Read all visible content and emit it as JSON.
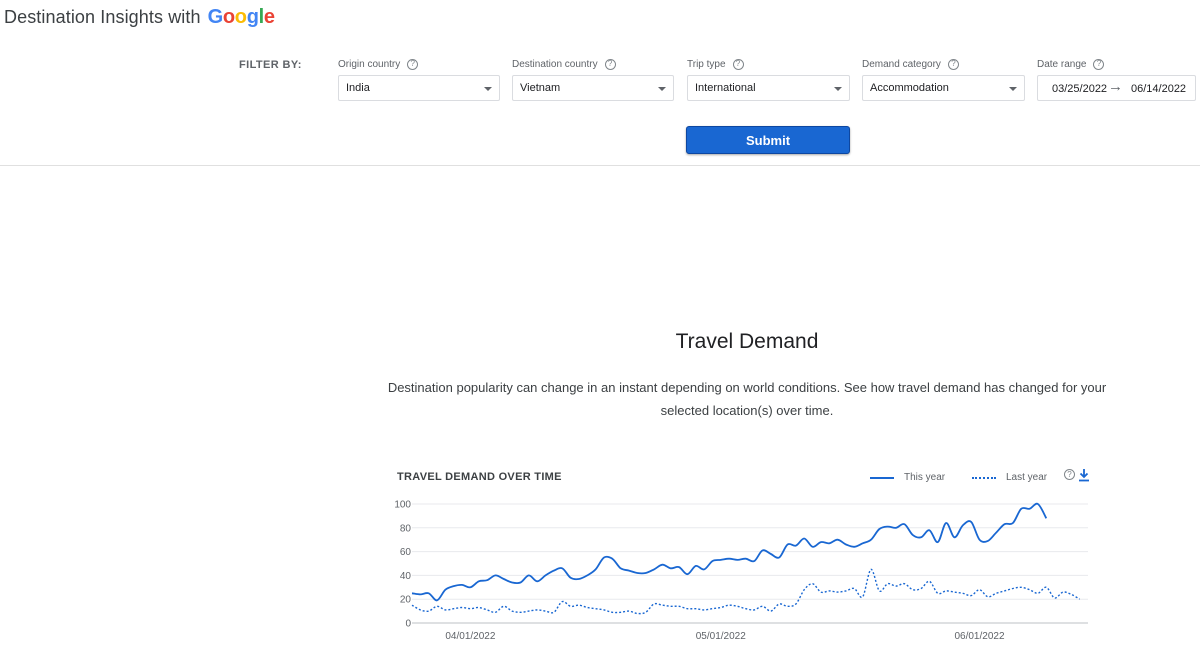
{
  "header": {
    "title": "Destination Insights with",
    "brand": "Google",
    "brand_colors": [
      "#4285f4",
      "#ea4335",
      "#fbbc05",
      "#4285f4",
      "#34a853",
      "#ea4335"
    ]
  },
  "filters": {
    "label": "FILTER BY:",
    "origin": {
      "label": "Origin country",
      "value": "India"
    },
    "destination": {
      "label": "Destination country",
      "value": "Vietnam"
    },
    "trip_type": {
      "label": "Trip type",
      "value": "International"
    },
    "demand_category": {
      "label": "Demand category",
      "value": "Accommodation"
    },
    "date_range": {
      "label": "Date range",
      "start": "03/25/2022",
      "end": "06/14/2022"
    },
    "help_glyph": "?",
    "submit_label": "Submit"
  },
  "section": {
    "title": "Travel Demand",
    "description": "Destination popularity can change in an instant depending on world conditions. See how travel demand has changed for your selected location(s) over time."
  },
  "colors": {
    "accent": "#1967d2",
    "grid": "#e8eaed"
  },
  "chart_data": {
    "type": "line",
    "title": "TRAVEL DEMAND OVER TIME",
    "ylim": [
      0,
      100
    ],
    "yticks": [
      0,
      20,
      40,
      60,
      80,
      100
    ],
    "x_tick_labels": [
      {
        "label": "04/01/2022",
        "day": 7
      },
      {
        "label": "05/01/2022",
        "day": 37
      },
      {
        "label": "06/01/2022",
        "day": 68
      }
    ],
    "x": [
      "03/25",
      "03/26",
      "03/27",
      "03/28",
      "03/29",
      "03/30",
      "03/31",
      "04/01",
      "04/02",
      "04/03",
      "04/04",
      "04/05",
      "04/06",
      "04/07",
      "04/08",
      "04/09",
      "04/10",
      "04/11",
      "04/12",
      "04/13",
      "04/14",
      "04/15",
      "04/16",
      "04/17",
      "04/18",
      "04/19",
      "04/20",
      "04/21",
      "04/22",
      "04/23",
      "04/24",
      "04/25",
      "04/26",
      "04/27",
      "04/28",
      "04/29",
      "04/30",
      "05/01",
      "05/02",
      "05/03",
      "05/04",
      "05/05",
      "05/06",
      "05/07",
      "05/08",
      "05/09",
      "05/10",
      "05/11",
      "05/12",
      "05/13",
      "05/14",
      "05/15",
      "05/16",
      "05/17",
      "05/18",
      "05/19",
      "05/20",
      "05/21",
      "05/22",
      "05/23",
      "05/24",
      "05/25",
      "05/26",
      "05/27",
      "05/28",
      "05/29",
      "05/30",
      "05/31",
      "06/01",
      "06/02",
      "06/03",
      "06/04",
      "06/05",
      "06/06",
      "06/07",
      "06/08",
      "06/09",
      "06/10",
      "06/11",
      "06/12",
      "06/13",
      "06/14"
    ],
    "series": [
      {
        "name": "This year",
        "style": "solid",
        "values": [
          25,
          24,
          25,
          19,
          28,
          31,
          32,
          30,
          35,
          36,
          40,
          37,
          34,
          34,
          40,
          35,
          40,
          44,
          46,
          38,
          37,
          40,
          45,
          55,
          54,
          46,
          44,
          42,
          42,
          45,
          49,
          46,
          47,
          41,
          48,
          45,
          52,
          53,
          54,
          53,
          54,
          52,
          61,
          58,
          55,
          66,
          65,
          71,
          64,
          68,
          67,
          70,
          66,
          64,
          67,
          70,
          79,
          81,
          80,
          83,
          74,
          72,
          78,
          68,
          84,
          72,
          82,
          85,
          70,
          69,
          76,
          83,
          84,
          96,
          96,
          100,
          88
        ]
      },
      {
        "name": "Last year",
        "style": "dotted",
        "values": [
          15,
          11,
          10,
          14,
          11,
          12,
          13,
          12,
          13,
          11,
          9,
          14,
          10,
          9,
          10,
          11,
          10,
          9,
          18,
          14,
          15,
          13,
          12,
          11,
          9,
          9,
          10,
          8,
          9,
          16,
          15,
          14,
          14,
          12,
          12,
          11,
          12,
          13,
          15,
          14,
          12,
          11,
          14,
          10,
          16,
          14,
          16,
          28,
          33,
          26,
          27,
          26,
          27,
          29,
          22,
          45,
          27,
          33,
          31,
          33,
          28,
          29,
          35,
          25,
          27,
          26,
          25,
          23,
          28,
          22,
          25,
          27,
          29,
          30,
          28,
          25,
          30,
          21,
          26,
          24,
          20
        ]
      }
    ]
  }
}
